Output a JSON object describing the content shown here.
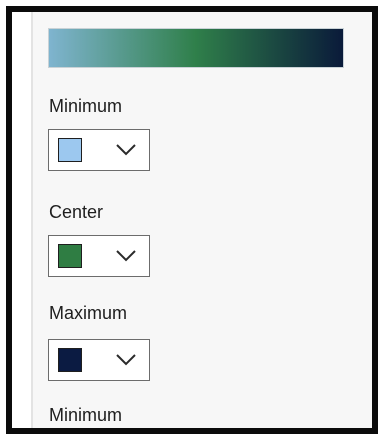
{
  "gradient": {
    "stops": [
      "#7fb4cf",
      "#2f7f4a",
      "#0a1a3a"
    ]
  },
  "colors": {
    "minimum": "#9cc8ef",
    "center": "#2f7d43",
    "maximum": "#0b1b42"
  },
  "fields": {
    "minimum_label": "Minimum",
    "center_label": "Center",
    "maximum_label": "Maximum",
    "minimum_label_2": "Minimum"
  },
  "icons": {
    "dropdown": "chevron-down-icon"
  }
}
